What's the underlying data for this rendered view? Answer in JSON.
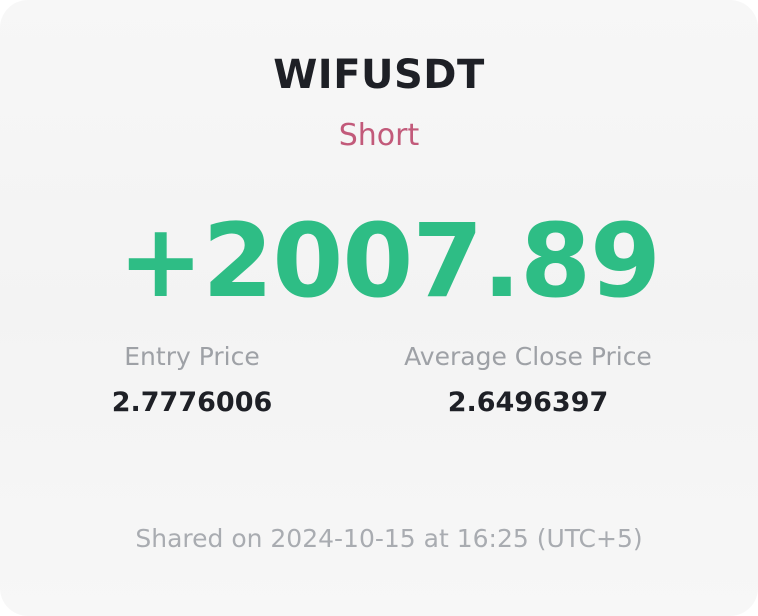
{
  "position": {
    "symbol": "WIFUSDT",
    "side": "Short",
    "pnl": "+2007.89"
  },
  "stats": {
    "entry_label": "Entry Price",
    "entry_value": "2.7776006",
    "close_label": "Average Close Price",
    "close_value": "2.6496397"
  },
  "footer": {
    "shared_text": "Shared on 2024-10-15 at 16:25 (UTC+5)"
  },
  "colors": {
    "profit": "#2ebd85",
    "short": "#c25a7a",
    "text_primary": "#1e2026",
    "text_secondary": "#9ea1a6"
  }
}
